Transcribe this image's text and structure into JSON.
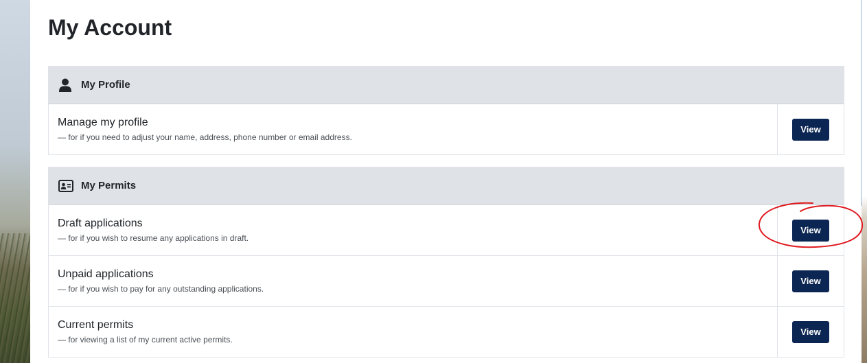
{
  "page": {
    "title": "My Account"
  },
  "profile_section": {
    "title": "My Profile",
    "icon": "user-icon",
    "rows": [
      {
        "title": "Manage my profile",
        "description": "— for if you need to adjust your name, address, phone number or email address.",
        "button": "View"
      }
    ]
  },
  "permits_section": {
    "title": "My Permits",
    "icon": "id-card-icon",
    "rows": [
      {
        "title": "Draft applications",
        "description": "— for if you wish to resume any applications in draft.",
        "button": "View"
      },
      {
        "title": "Unpaid applications",
        "description": "— for if you wish to pay for any outstanding applications.",
        "button": "View"
      },
      {
        "title": "Current permits",
        "description": "— for viewing a list of my current active permits.",
        "button": "View"
      }
    ]
  },
  "colors": {
    "button_bg": "#0b2652",
    "header_bg": "#dfe3e8",
    "annotation": "#e0191f"
  }
}
